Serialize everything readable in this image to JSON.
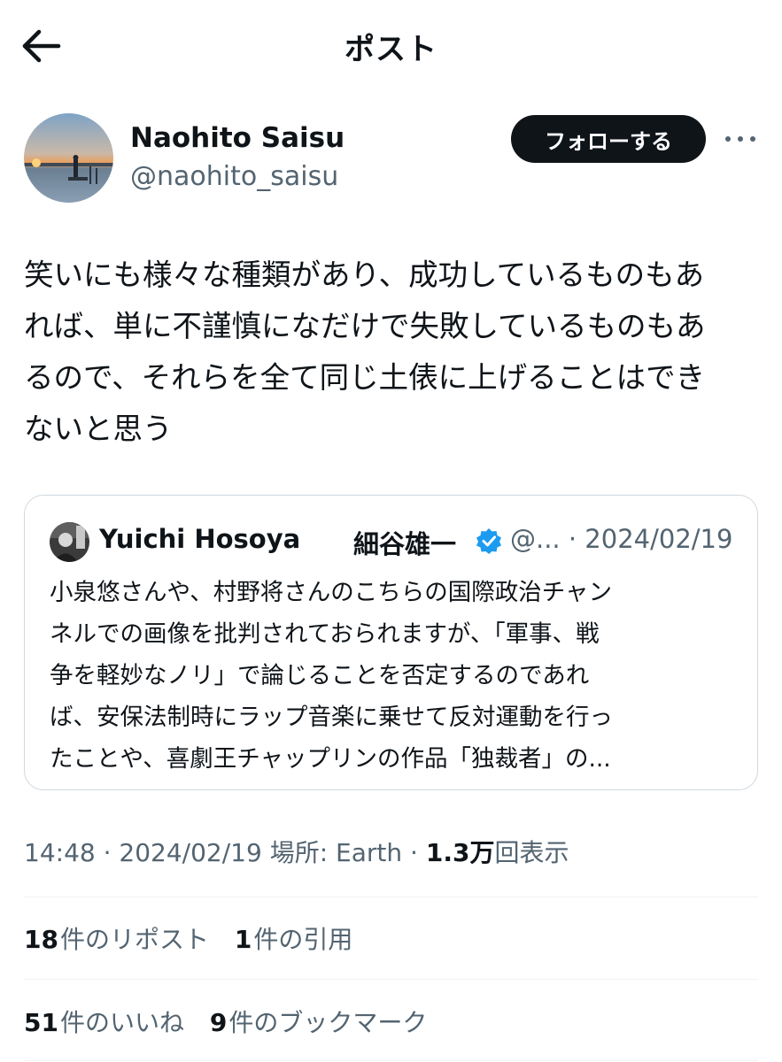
{
  "header": {
    "title": "ポスト"
  },
  "author": {
    "name": "Naohito Saisu",
    "handle": "@naohito_saisu",
    "follow_label": "フォローする"
  },
  "post": {
    "lines": [
      "笑いにも様々な種類があり、成功しているものもあ",
      "れば、単に不謹慎になだけで失敗しているものもあ",
      "るので、それらを全て同じ土俵に上げることはでき",
      "ないと思う"
    ]
  },
  "quote": {
    "name": "Yuichi Hosoya",
    "name_jp": "細谷雄一",
    "meta": "@... · 2024/02/19",
    "verified_color": "#1d9bf0",
    "lines": [
      "小泉悠さんや、村野将さんのこちらの国際政治チャン",
      "ネルでの画像を批判されておられますが、「軍事、戦",
      "争を軽妙なノリ」で論じることを否定するのであれ",
      "ば、安保法制時にラップ音楽に乗せて反対運動を行っ",
      "たことや、喜劇王チャップリンの作品「独裁者」の..."
    ]
  },
  "meta": {
    "time": "14:48",
    "date": "2024/02/19",
    "location": "場所: Earth",
    "views_count": "1.3",
    "views_unit": "万",
    "views_label": "回表示"
  },
  "stats": {
    "reposts_count": "18",
    "reposts_label": "件のリポスト",
    "quotes_count": "1",
    "quotes_label": "件の引用",
    "likes_count": "51",
    "likes_label": "件のいいね",
    "bookmarks_count": "9",
    "bookmarks_label": "件のブックマーク"
  }
}
